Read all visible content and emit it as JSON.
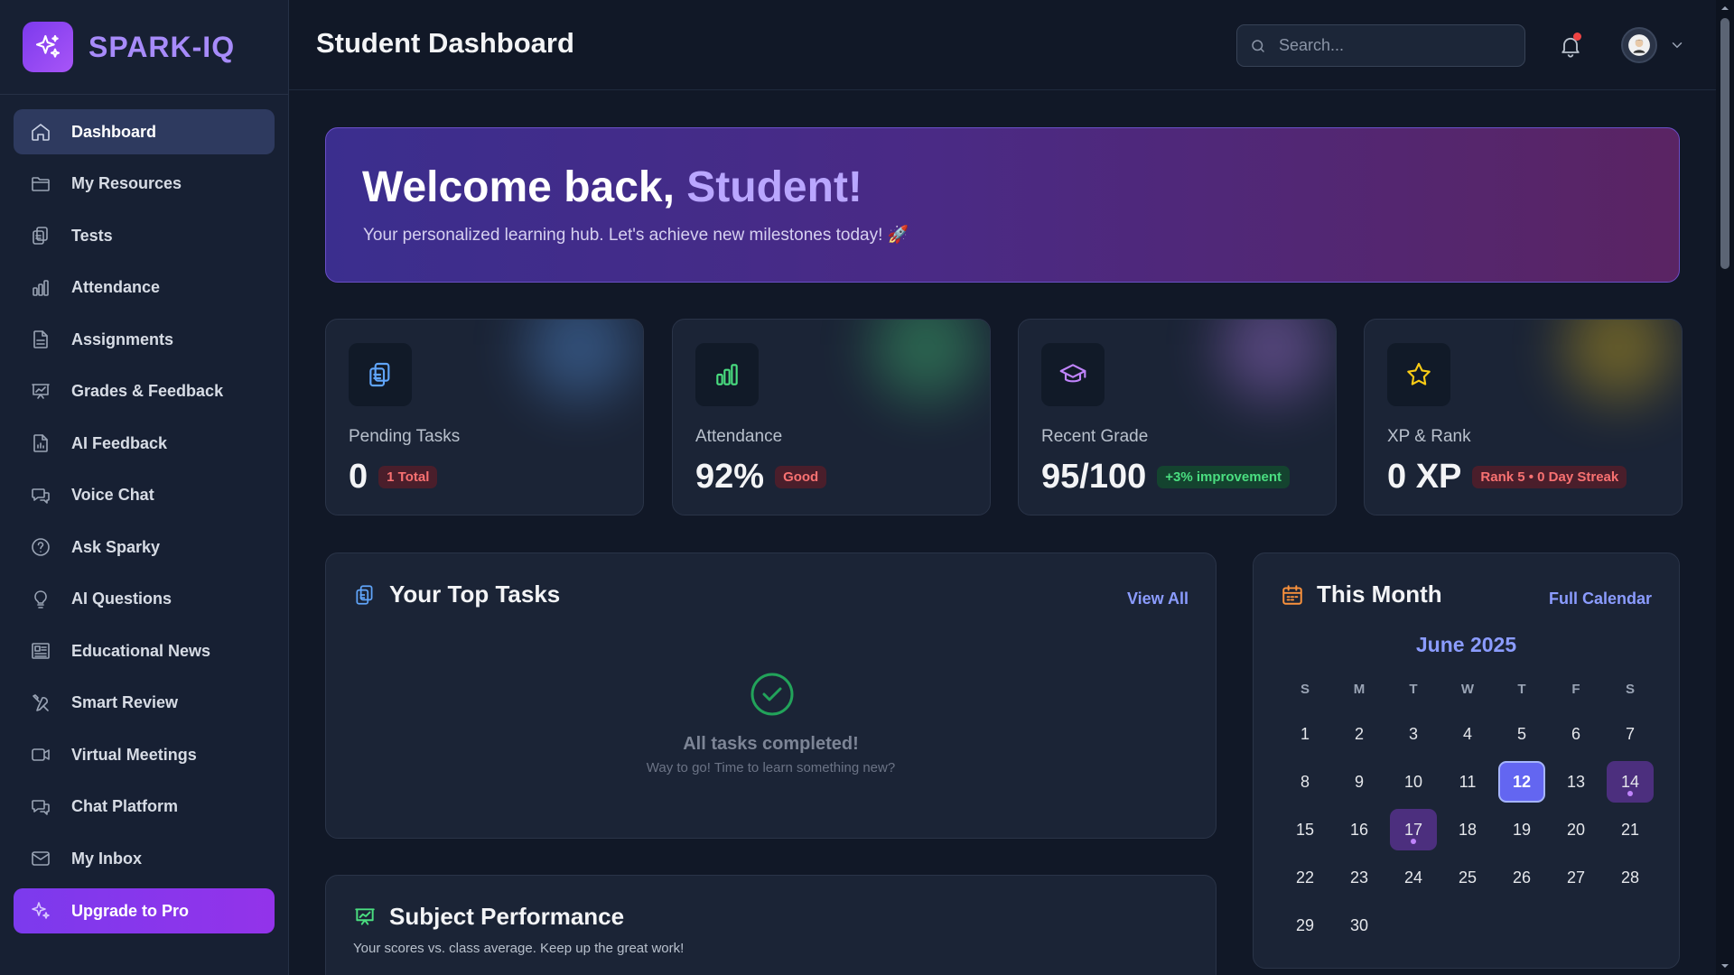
{
  "brand": {
    "name": "SPARK-IQ",
    "icon": "sparkles-icon"
  },
  "sidebar": {
    "items": [
      {
        "label": "Dashboard",
        "icon": "home-icon",
        "active": true
      },
      {
        "label": "My Resources",
        "icon": "folder-icon"
      },
      {
        "label": "Tests",
        "icon": "clipboard-icon"
      },
      {
        "label": "Attendance",
        "icon": "bar-chart-icon"
      },
      {
        "label": "Assignments",
        "icon": "document-icon"
      },
      {
        "label": "Grades & Feedback",
        "icon": "presentation-chart-icon"
      },
      {
        "label": "AI Feedback",
        "icon": "document-chart-icon"
      },
      {
        "label": "Voice Chat",
        "icon": "chat-bubbles-icon"
      },
      {
        "label": "Ask Sparky",
        "icon": "question-circle-icon"
      },
      {
        "label": "AI Questions",
        "icon": "lightbulb-icon"
      },
      {
        "label": "Educational News",
        "icon": "newspaper-icon"
      },
      {
        "label": "Smart Review",
        "icon": "tools-icon"
      },
      {
        "label": "Virtual Meetings",
        "icon": "video-camera-icon"
      },
      {
        "label": "Chat Platform",
        "icon": "chat-bubbles-icon"
      },
      {
        "label": "My Inbox",
        "icon": "envelope-icon"
      }
    ],
    "upgrade": {
      "label": "Upgrade to Pro",
      "icon": "sparkles-icon"
    }
  },
  "header": {
    "title": "Student Dashboard",
    "search_placeholder": "Search...",
    "has_notification": true
  },
  "welcome": {
    "greeting": "Welcome back, ",
    "name": "Student!",
    "subtitle": "Your personalized learning hub. Let's achieve new milestones today! 🚀"
  },
  "stats": [
    {
      "label": "Pending Tasks",
      "value": "0",
      "badge": "1 Total",
      "badge_tone": "red",
      "icon": "clipboard-icon",
      "accent": "#60a5fa"
    },
    {
      "label": "Attendance",
      "value": "92%",
      "badge": "Good",
      "badge_tone": "red",
      "icon": "bar-chart-icon",
      "accent": "#4ade80"
    },
    {
      "label": "Recent Grade",
      "value": "95/100",
      "badge": "+3% improvement",
      "badge_tone": "green",
      "icon": "graduation-cap-icon",
      "accent": "#c084fc"
    },
    {
      "label": "XP & Rank",
      "value": "0 XP",
      "badge": "Rank 5 • 0 Day Streak",
      "badge_tone": "red",
      "icon": "star-icon",
      "accent": "#facc15"
    }
  ],
  "tasks": {
    "title": "Your Top Tasks",
    "view_all": "View All",
    "empty_title": "All tasks completed!",
    "empty_subtitle": "Way to go! Time to learn something new?"
  },
  "performance": {
    "title": "Subject Performance",
    "subtitle": "Your scores vs. class average. Keep up the great work!"
  },
  "calendar": {
    "title": "This Month",
    "full_calendar": "Full Calendar",
    "month": "June 2025",
    "weekdays": [
      "S",
      "M",
      "T",
      "W",
      "T",
      "F",
      "S"
    ],
    "weeks": [
      [
        "1",
        "2",
        "3",
        "4",
        "5",
        "6",
        "7"
      ],
      [
        "8",
        "9",
        "10",
        "11",
        "12",
        "13",
        "14"
      ],
      [
        "15",
        "16",
        "17",
        "18",
        "19",
        "20",
        "21"
      ],
      [
        "22",
        "23",
        "24",
        "25",
        "26",
        "27",
        "28"
      ],
      [
        "29",
        "30",
        "",
        "",
        "",
        "",
        ""
      ]
    ],
    "today": "12",
    "event_days": [
      "14",
      "17"
    ]
  },
  "colors": {
    "accent": "#6366f1",
    "brand": "#a78bfa",
    "link": "#8b9cff",
    "sidebar_bg": "#172033",
    "page_bg": "#111827"
  }
}
